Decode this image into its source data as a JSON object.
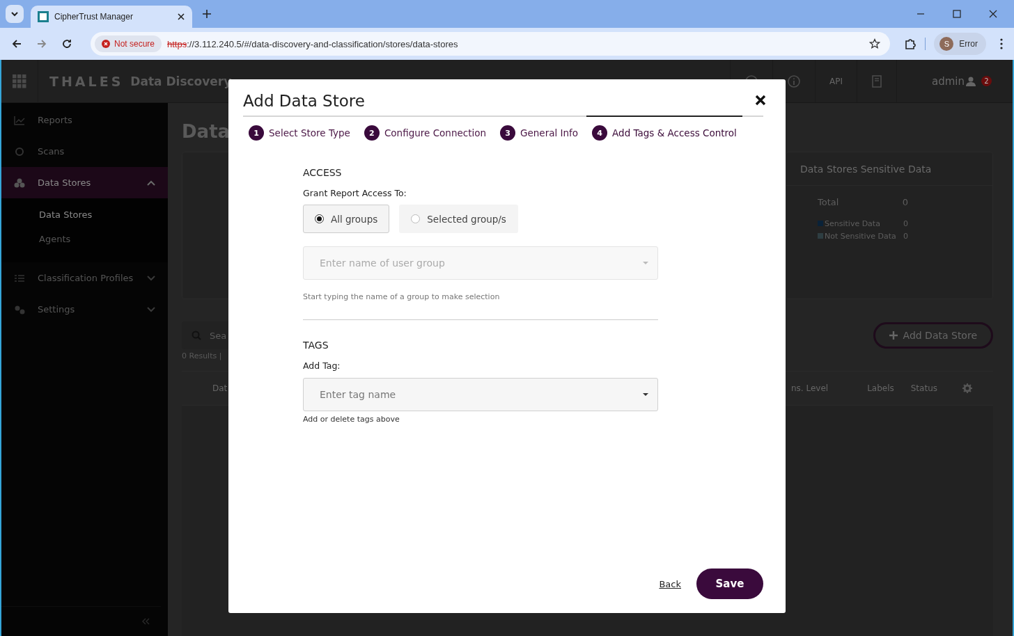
{
  "browser": {
    "tab_title": "CipherTrust Manager",
    "security": "Not secure",
    "url_scheme": "https",
    "url_rest": "://3.112.240.5/#/data-discovery-and-classification/stores/data-stores",
    "profile_initial": "S",
    "profile_label": "Error"
  },
  "app_header": {
    "brand": "THALES",
    "product": "Data Discovery",
    "api": "API",
    "user": "admin",
    "alert_count": "2"
  },
  "sidebar": {
    "items": [
      {
        "label": "Reports",
        "selected": false,
        "kind": "link"
      },
      {
        "label": "Scans",
        "selected": false,
        "kind": "link"
      },
      {
        "label": "Data Stores",
        "expanded": true,
        "selected": true,
        "children": [
          {
            "label": "Data Stores",
            "selected": true
          },
          {
            "label": "Agents",
            "selected": false
          }
        ],
        "kind": "group"
      },
      {
        "label": "Classification Profiles",
        "expanded": false,
        "selected": false,
        "kind": "group"
      },
      {
        "label": "Settings",
        "expanded": false,
        "selected": false,
        "kind": "group"
      }
    ]
  },
  "main": {
    "heading": "Data",
    "summary": {
      "title": "Data Stores Sensitive Data",
      "total_label": "Total",
      "total_value": "0",
      "legend": [
        {
          "label": "Sensitive Data",
          "value": "0",
          "color": "#0a2238"
        },
        {
          "label": "Not Sensitive Data",
          "value": "0",
          "color": "#2e3e42"
        }
      ]
    },
    "search_placeholder": "Sea",
    "results": "0 Results |",
    "add_button": "Add Data Store",
    "columns": [
      "Dat",
      "ns. Level",
      "Labels",
      "Status"
    ]
  },
  "modal": {
    "title": "Add Data Store",
    "steps": [
      {
        "number": "1",
        "label": "Select Store Type",
        "selected": false
      },
      {
        "number": "2",
        "label": "Configure Connection",
        "selected": false
      },
      {
        "number": "3",
        "label": "General Info",
        "selected": false
      },
      {
        "number": "4",
        "label": "Add Tags & Access Control",
        "selected": true
      }
    ],
    "access_heading": "ACCESS",
    "grant_label": "Grant Report Access To:",
    "options": [
      {
        "label": "All groups",
        "selected": true
      },
      {
        "label": "Selected group/s",
        "selected": false
      }
    ],
    "group_field": {
      "placeholder": "Enter name of user group",
      "disabled": true
    },
    "group_hint": "Start typing the name of a group to make selection",
    "tags_heading": "TAGS",
    "tag_label": "Add Tag:",
    "tag_field": {
      "placeholder": "Enter tag name",
      "disabled": false
    },
    "tag_hint": "Add or delete tags above",
    "back": "Back",
    "save": "Save"
  }
}
